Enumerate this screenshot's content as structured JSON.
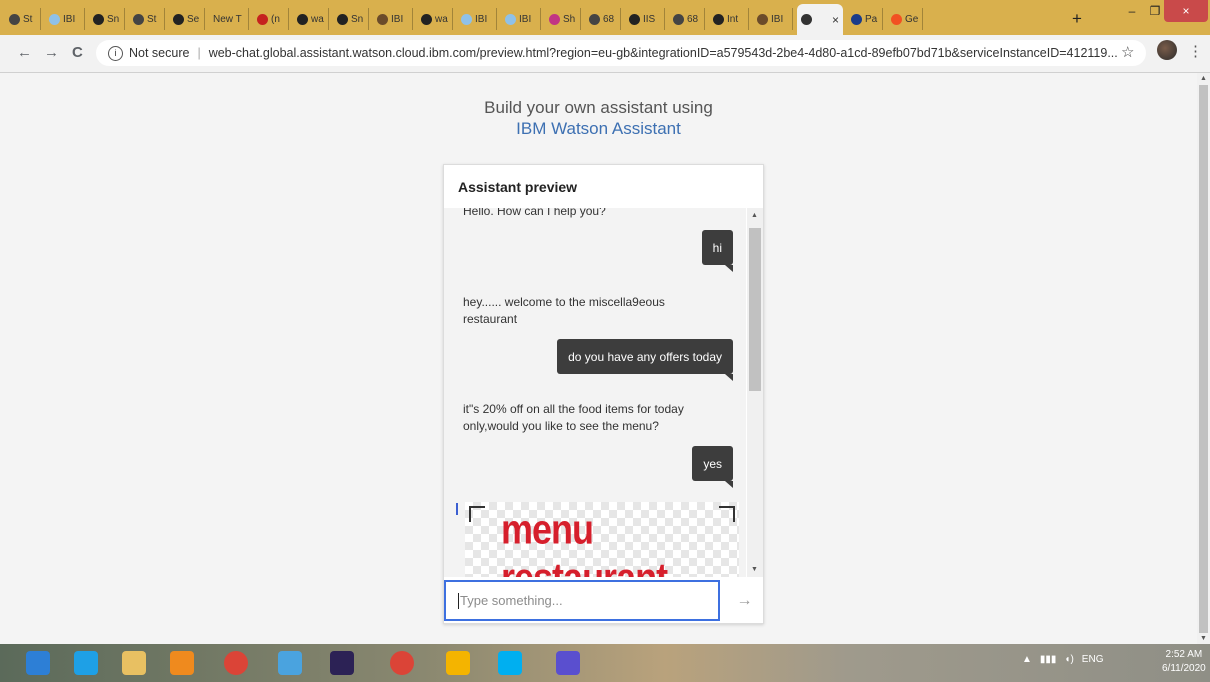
{
  "browser": {
    "tabs": [
      {
        "label": "St",
        "color": "#444"
      },
      {
        "label": "IBI",
        "color": "#8fc1e8"
      },
      {
        "label": "Sn",
        "color": "#222"
      },
      {
        "label": "St",
        "color": "#444"
      },
      {
        "label": "Se",
        "color": "#222"
      },
      {
        "label": "New T",
        "color": ""
      },
      {
        "label": "(n",
        "color": "#c5221f"
      },
      {
        "label": "wa",
        "color": "#222"
      },
      {
        "label": "Sn",
        "color": "#222"
      },
      {
        "label": "IBI",
        "color": "#6b4b2a"
      },
      {
        "label": "wa",
        "color": "#222"
      },
      {
        "label": "IBI",
        "color": "#8fc1e8"
      },
      {
        "label": "IBI",
        "color": "#8fc1e8"
      },
      {
        "label": "Sh",
        "color": "#c13584"
      },
      {
        "label": "68",
        "color": "#444"
      },
      {
        "label": "IIS",
        "color": "#222"
      },
      {
        "label": "68",
        "color": "#444"
      },
      {
        "label": "Int",
        "color": "#222"
      },
      {
        "label": "IBI",
        "color": "#6b4b2a"
      },
      {
        "label": "",
        "color": "#333",
        "active": true
      },
      {
        "label": "Pa",
        "color": "#1a3b8a"
      },
      {
        "label": "Ge",
        "color": "#f25022"
      }
    ],
    "active_tab_close": "×",
    "new_tab": "+",
    "window_minimize": "–",
    "window_restore": "❐",
    "window_close": "×",
    "nav_back": "←",
    "nav_forward": "→",
    "nav_reload": "C",
    "security_label": "Not secure",
    "url": "web-chat.global.assistant.watson.cloud.ibm.com/preview.html?region=eu-gb&integrationID=a579543d-2be4-4d80-a1cd-89efb07bd71b&serviceInstanceID=412119...",
    "bookmark": "☆",
    "menu": "⋮"
  },
  "page": {
    "heading_line1": "Build your own assistant using",
    "heading_line2": "IBM Watson Assistant",
    "accent_color": "#3d70b2"
  },
  "assistant": {
    "header": "Assistant preview",
    "messages": [
      {
        "from": "bot",
        "text": "Hello. How can I help you?"
      },
      {
        "from": "user",
        "text": "hi"
      },
      {
        "from": "bot",
        "text": "hey...... welcome to the miscella9eous restaurant"
      },
      {
        "from": "user",
        "text": "do you have any offers today"
      },
      {
        "from": "bot",
        "text": "it\"s 20% off on all the food items for today only,would you like to see the menu?"
      },
      {
        "from": "user",
        "text": "yes"
      }
    ],
    "image_text": "menu restaurant",
    "input_placeholder": "Type something...",
    "send_icon": "→"
  },
  "taskbar": {
    "apps": [
      "start",
      "internet-explorer",
      "file-explorer",
      "vlc",
      "chrome",
      "notepad",
      "eclipse",
      "chrome",
      "slides",
      "skype",
      "settings"
    ],
    "language": "ENG",
    "time": "2:52 AM",
    "date": "6/11/2020"
  }
}
